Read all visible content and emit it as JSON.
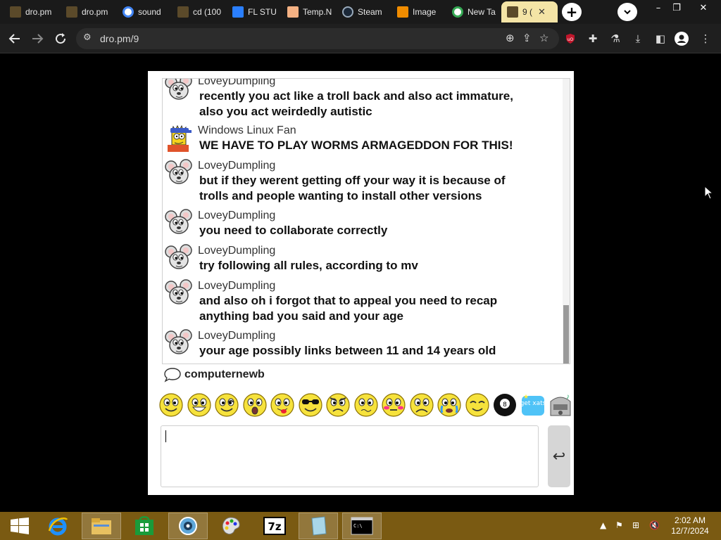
{
  "browser": {
    "tabs": [
      {
        "title": "dro.pm",
        "icon": "folder-icon",
        "color": "#5b4a2a"
      },
      {
        "title": "dro.pm",
        "icon": "folder-icon",
        "color": "#5b4a2a"
      },
      {
        "title": "sound",
        "icon": "google-icon",
        "color": "#ffffff"
      },
      {
        "title": "cd (100",
        "icon": "folder-icon",
        "color": "#5b4a2a"
      },
      {
        "title": "FL STU",
        "icon": "play-icon",
        "color": "#2a7fff"
      },
      {
        "title": "Temp.N",
        "icon": "home-icon",
        "color": "#f4b183"
      },
      {
        "title": "Steam",
        "icon": "steam-icon",
        "color": "#1b2838"
      },
      {
        "title": "Image",
        "icon": "image-icon",
        "color": "#f08c00"
      },
      {
        "title": "New Ta",
        "icon": "chrome-icon",
        "color": "#ffffff"
      },
      {
        "title": "9 (",
        "icon": "folder-icon",
        "color": "#5b4a2a"
      }
    ],
    "url": "dro.pm/9",
    "new_tab_glyph": "+",
    "close_glyph": "✕",
    "minimize_glyph": "–",
    "maximize_glyph": "❐",
    "window_close_glyph": "✕"
  },
  "chat": {
    "messages": [
      {
        "user": "LoveyDumpling",
        "avatar": "mouse",
        "lines": [
          "recently you act like a troll back and also act immature,",
          "also you act weirdedly autistic"
        ]
      },
      {
        "user": "Windows Linux Fan",
        "avatar": "bart",
        "lines": [
          "WE HAVE TO PLAY WORMS ARMAGEDDON FOR THIS!"
        ]
      },
      {
        "user": "LoveyDumpling",
        "avatar": "mouse",
        "lines": [
          "but if they werent getting off your way it is because of",
          "trolls and people wanting to install other versions"
        ]
      },
      {
        "user": "LoveyDumpling",
        "avatar": "mouse",
        "lines": [
          "you need to collaborate correctly"
        ]
      },
      {
        "user": "LoveyDumpling",
        "avatar": "mouse",
        "lines": [
          "try following all rules, according to mv"
        ]
      },
      {
        "user": "LoveyDumpling",
        "avatar": "mouse",
        "lines": [
          "and also oh i forgot that to appeal you need to recap",
          "anything bad you said and your age"
        ]
      },
      {
        "user": "LoveyDumpling",
        "avatar": "mouse",
        "lines": [
          "your age possibly links between 11 and 14 years old"
        ]
      }
    ],
    "typing_user": "computernewb",
    "smileys": [
      "smile",
      "biggrin",
      "wink",
      "surprised",
      "tongue",
      "cool",
      "mad",
      "confused",
      "redface",
      "frown",
      "cry",
      "content",
      "8ball",
      "getxats",
      "jukebox"
    ],
    "getxats_label": "get xats",
    "eightball_label": "8",
    "send_glyph": "↩",
    "input_value": ""
  },
  "taskbar": {
    "time": "2:02 AM",
    "date": "12/7/2024",
    "apps": [
      "start",
      "internet-explorer",
      "file-explorer",
      "store",
      "vm-viewer",
      "paint",
      "7zip",
      "notepad",
      "command-prompt"
    ],
    "sevenzip_label": "7z",
    "cmd_label": "C:\\"
  },
  "colors": {
    "taskbar": "#7a5a12",
    "active_tab": "#f4e4a6",
    "smiley_yellow": "#f6e23c"
  }
}
